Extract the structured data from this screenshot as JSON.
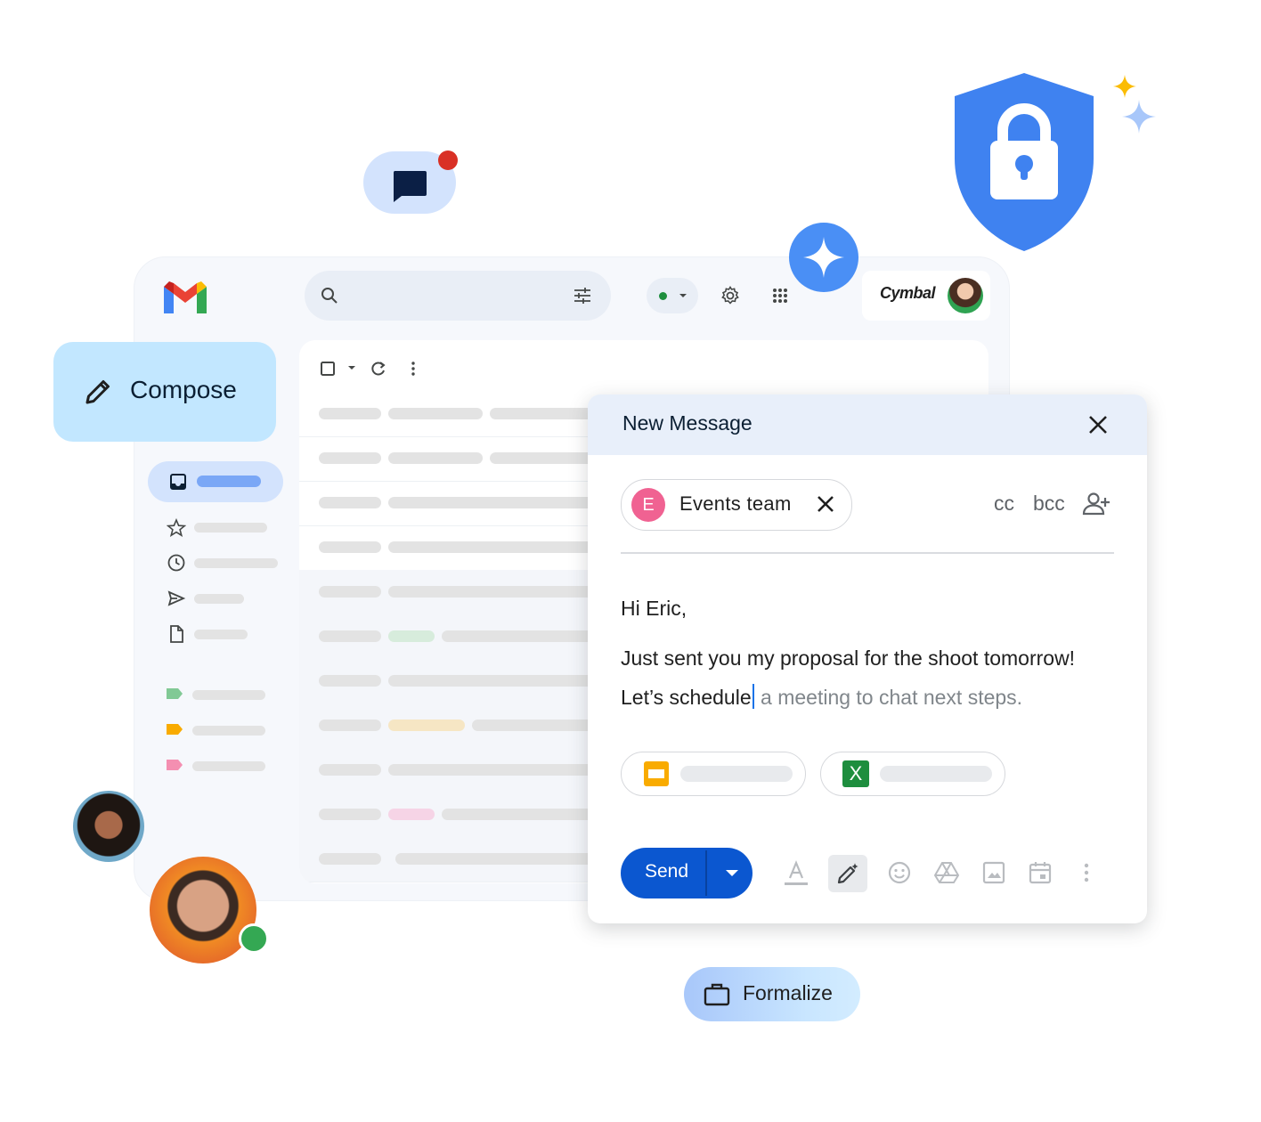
{
  "brand": {
    "account_name": "Cymbal"
  },
  "compose": {
    "label": "Compose"
  },
  "new_message": {
    "title": "New Message",
    "recipient": {
      "initial": "E",
      "name": "Events team"
    },
    "cc_label": "cc",
    "bcc_label": "bcc",
    "greeting": "Hi Eric,",
    "line1": "Just sent you my proposal for the shoot tomorrow!",
    "line2_typed": "Let’s schedule",
    "line2_suggestion": " a meeting to chat next steps.",
    "send_label": "Send"
  },
  "attachments": [
    {
      "type": "slides-icon"
    },
    {
      "type": "sheets-icon",
      "glyph": "X"
    }
  ],
  "formalize": {
    "label": "Formalize"
  },
  "colors": {
    "compose_bg": "#c2e7ff",
    "send_bg": "#0b57d0",
    "header_bg": "#e8effa",
    "shield": "#3f82f0",
    "chip_avatar": "#f06292"
  }
}
